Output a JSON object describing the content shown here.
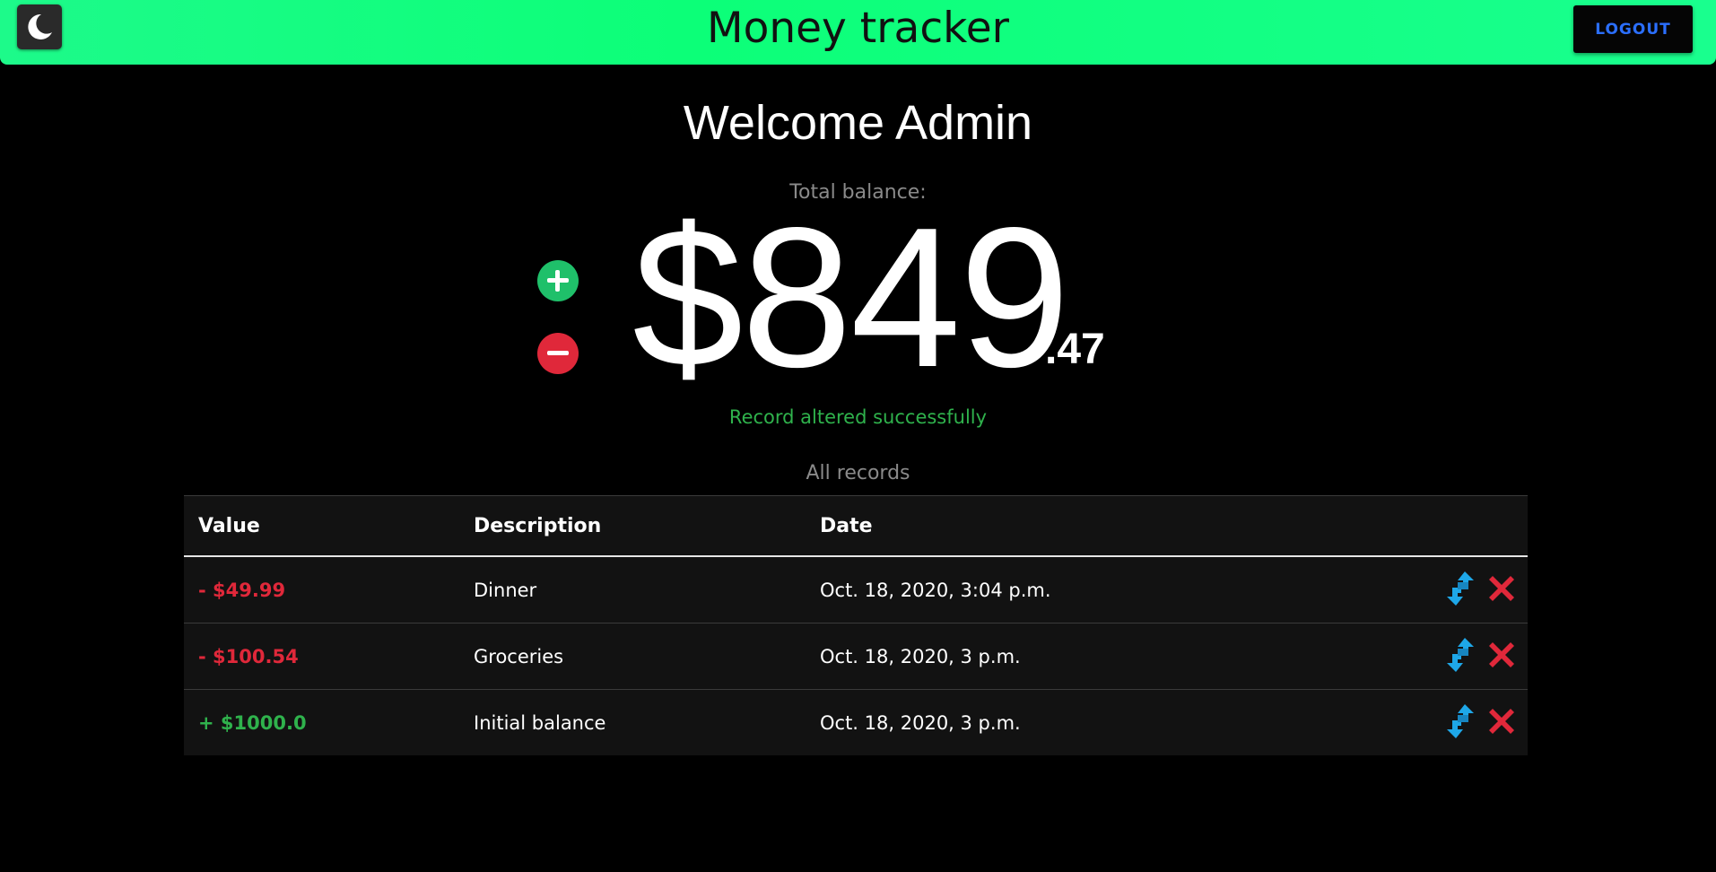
{
  "header": {
    "title": "Money tracker",
    "logout_label": "LOGOUT",
    "theme_icon": "moon-icon"
  },
  "main": {
    "welcome": "Welcome Admin",
    "balance_label": "Total balance:",
    "balance_whole": "$849",
    "balance_cents": ".47",
    "add_icon": "plus-icon",
    "subtract_icon": "minus-icon",
    "status_message": "Record altered successfully",
    "records_caption": "All records"
  },
  "table": {
    "columns": [
      "Value",
      "Description",
      "Date"
    ],
    "rows": [
      {
        "value": "- $49.99",
        "description": "Dinner",
        "date": "Oct. 18, 2020, 3:04 p.m.",
        "type": "expense"
      },
      {
        "value": "- $100.54",
        "description": "Groceries",
        "date": "Oct. 18, 2020, 3 p.m.",
        "type": "expense"
      },
      {
        "value": "+ $1000.0",
        "description": "Initial balance",
        "date": "Oct. 18, 2020, 3 p.m.",
        "type": "income"
      }
    ],
    "row_actions": [
      "edit-icon",
      "delete-icon"
    ]
  },
  "colors": {
    "header_green": "#0cff78",
    "income_green": "#2fb24c",
    "expense_red": "#e0283a",
    "logout_text_blue": "#2b6fff",
    "edit_blue": "#1ea7e8"
  }
}
